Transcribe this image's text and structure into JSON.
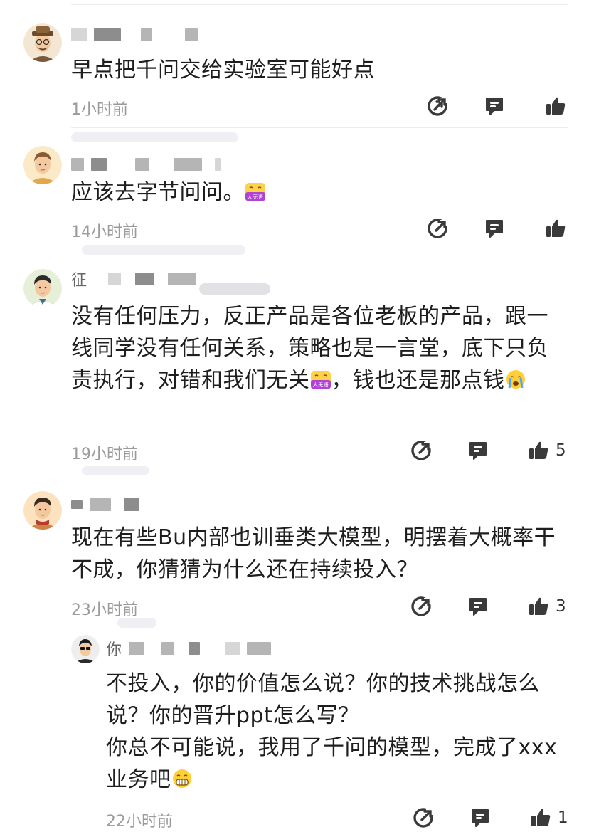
{
  "comments": [
    {
      "name_visible": "",
      "text": "早点把千问交给实验室可能好点",
      "time": "1小时前",
      "likes": ""
    },
    {
      "name_visible": "",
      "text": "应该去字节问问。",
      "time": "14小时前",
      "likes": ""
    },
    {
      "name_visible": "征",
      "text_parts": [
        "没有任何压力，反正产品是各位老板的产品，跟一线同学没有任何关系，策略也是一言堂，底下只负责执行，对错和我们无关",
        "，钱也还是那点钱"
      ],
      "time": "19小时前",
      "likes": "5"
    },
    {
      "name_visible": "",
      "text": "现在有些Bu内部也训垂类大模型，明摆着大概率干不成，你猜猜为什么还在持续投入？",
      "time": "23小时前",
      "likes": "3"
    }
  ],
  "reply": {
    "name_visible": "你",
    "line1": "不投入，你的价值怎么说？你的技术挑战怎么说？你的晋升ppt怎么写？",
    "line2": "你总不可能说，我用了千问的模型，完成了xxx业务吧",
    "time": "22小时前",
    "likes": "1"
  },
  "emoji_text": {
    "meme": "大无语"
  },
  "icons": {
    "share": "share-icon",
    "comment": "comment-icon",
    "like": "thumbs-up-icon"
  }
}
